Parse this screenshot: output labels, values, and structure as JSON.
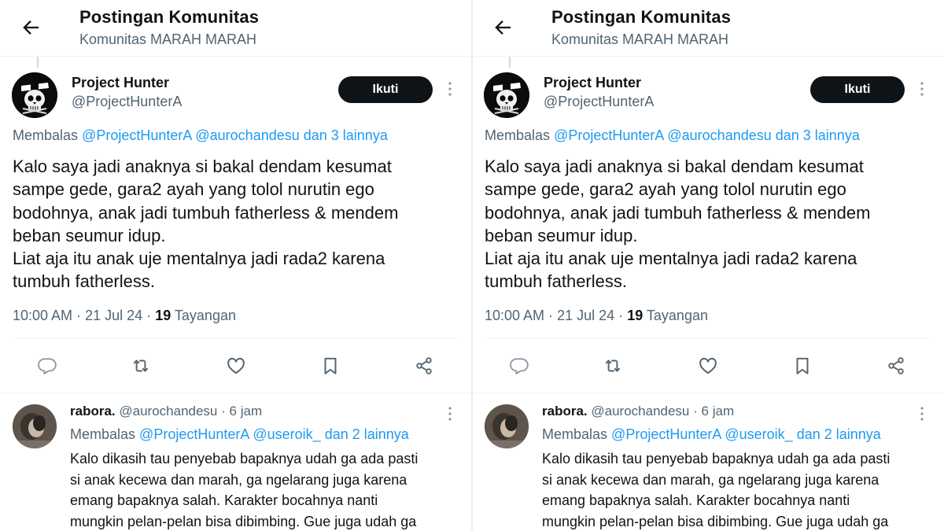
{
  "header": {
    "title": "Postingan Komunitas",
    "subtitle": "Komunitas MARAH MARAH"
  },
  "post": {
    "author_name": "Project Hunter",
    "author_handle": "@ProjectHunterA",
    "follow_label": "Ikuti",
    "replying_prefix": "Membalas",
    "replying_mentions": "@ProjectHunterA @aurochandesu dan 3 lainnya",
    "text_lines": [
      "Kalo saya jadi anaknya si bakal dendam kesumat",
      "sampe gede, gara2 ayah yang tolol nurutin ego",
      "bodohnya, anak jadi tumbuh fatherless & mendem",
      "beban seumur idup.",
      "Liat aja itu anak uje mentalnya jadi rada2 karena",
      "tumbuh fatherless."
    ],
    "time": "10:00 AM",
    "dot": "·",
    "date": "21 Jul 24",
    "views_count": "19",
    "views_label": "Tayangan"
  },
  "actions": [
    {
      "icon": "reply-icon"
    },
    {
      "icon": "retweet-icon"
    },
    {
      "icon": "heart-icon"
    },
    {
      "icon": "bookmark-icon"
    },
    {
      "icon": "share-icon"
    }
  ],
  "reply": {
    "author_name": "rabora.",
    "author_handle": "@aurochandesu",
    "dot": "·",
    "time_ago": "6 jam",
    "replying_prefix": "Membalas",
    "replying_mentions": "@ProjectHunterA @useroik_ dan 2 lainnya",
    "text_lines": [
      "Kalo dikasih tau penyebab bapaknya udah ga ada pasti",
      "si anak kecewa dan marah, ga ngelarang juga karena",
      "emang bapaknya salah. Karakter bocahnya nanti",
      "mungkin pelan-pelan bisa dibimbing. Gue juga udah ga"
    ]
  },
  "colors": {
    "text": "#0f1419",
    "secondary": "#536471",
    "link": "#1d9bf0",
    "button_bg": "#0f1419"
  }
}
